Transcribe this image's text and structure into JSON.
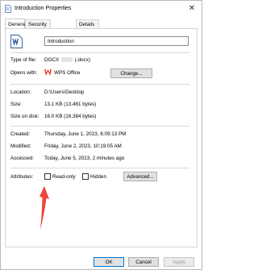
{
  "window": {
    "title": "Introduction Properties"
  },
  "tabs": [
    "General",
    "Security",
    "Details"
  ],
  "file": {
    "name": "Introduction"
  },
  "type_of_file": {
    "label": "Type of file:",
    "value_prefix": "DOCX",
    "value_suffix": "(.docx)"
  },
  "opens_with": {
    "label": "Opens with:",
    "value": "WPS Office",
    "button": "Change..."
  },
  "location": {
    "label": "Location:",
    "value": "D:\\Users\\Desktop"
  },
  "size": {
    "label": "Size:",
    "value": "13.1 KB (13,481 bytes)"
  },
  "size_on_disk": {
    "label": "Size on disk:",
    "value": "16.0 KB (16,384 bytes)"
  },
  "created": {
    "label": "Created:",
    "value": "Thursday, June 1, 2023, 6:09:13 PM"
  },
  "modified": {
    "label": "Modified:",
    "value": "Friday, June 2, 2023, 10:19:05 AM"
  },
  "accessed": {
    "label": "Accessed:",
    "value": "Today, June 5, 2023, 2 minutes ago"
  },
  "attributes": {
    "label": "Attributes:",
    "readonly": "Read-only",
    "hidden": "Hidden",
    "advanced": "Advanced..."
  },
  "footer": {
    "ok": "OK",
    "cancel": "Cancel",
    "apply": "Apply"
  },
  "colors": {
    "accent": "#0078d7",
    "wps_red": "#e8392b",
    "arrow_red": "#f0453a",
    "word_blue": "#2b579a"
  }
}
